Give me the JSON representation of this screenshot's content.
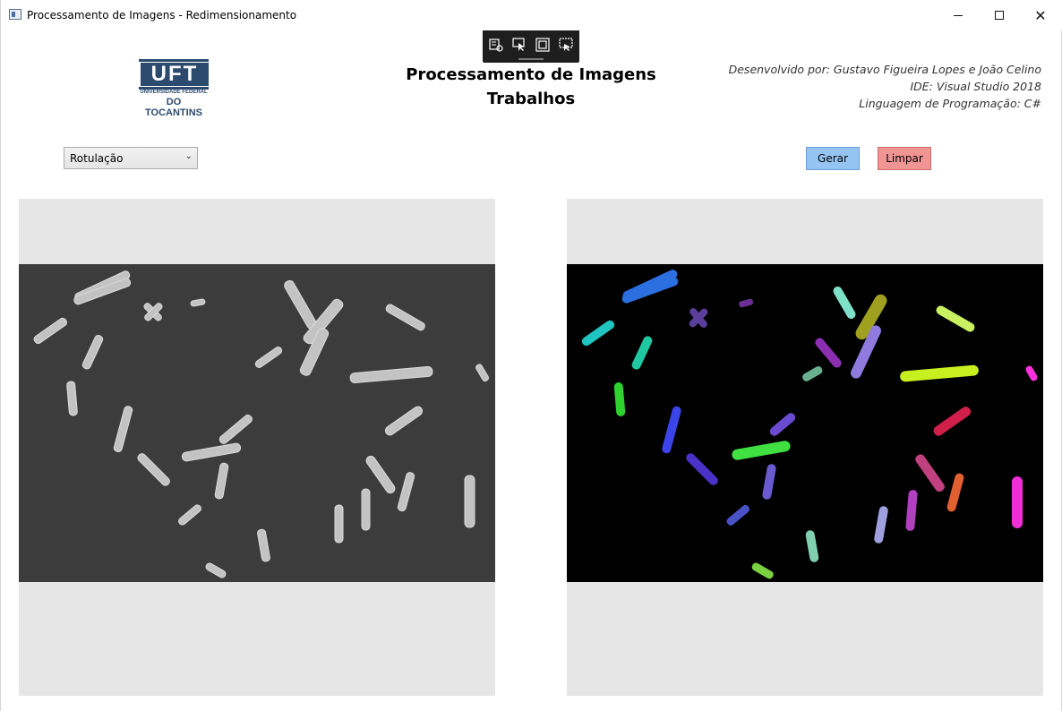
{
  "window": {
    "title": "Processamento de Imagens - Redimensionamento",
    "min_label": "",
    "max_label": "",
    "close_label": "✕"
  },
  "header": {
    "logo_text": "UFT",
    "logo_sub1": "UNIVERSIDADE FEDERAL",
    "logo_sub2": "DO TOCANTINS",
    "title_line1": "Processamento de Imagens",
    "title_line2": "Trabalhos",
    "credits": {
      "developers": "Desenvolvido por: Gustavo Figueira Lopes e João Celino",
      "ide": "IDE: Visual Studio 2018",
      "language": "Linguagem de Programação: C#"
    }
  },
  "controls": {
    "operation_select": "Rotulação",
    "generate_button": "Gerar",
    "clear_button": "Limpar"
  },
  "colors": {
    "generate_button": "#96c4f2",
    "clear_button": "#f09494",
    "panel_bg": "#e6e6e6",
    "original_bg": "#3c3c3c",
    "labeled_bg": "#000000"
  },
  "debug_toolbar": {
    "icons": [
      "live-visual-tree-icon",
      "select-element-icon",
      "display-layout-adorners-icon",
      "track-focus-icon"
    ]
  }
}
